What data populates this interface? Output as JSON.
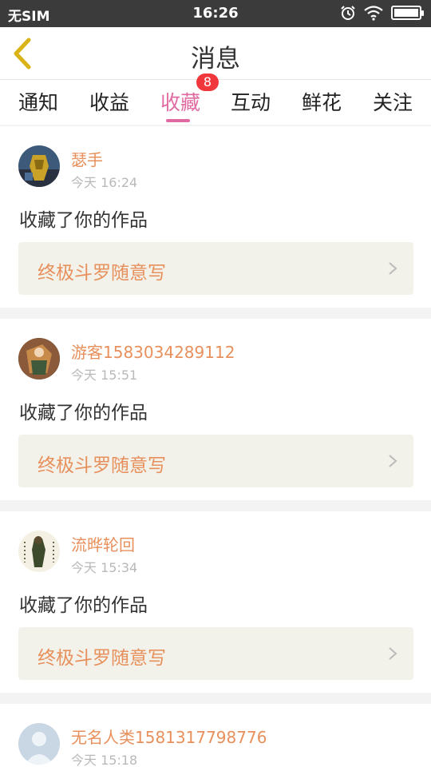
{
  "status_bar": {
    "carrier": "无SIM",
    "time": "16:26",
    "battery_level": 1.0
  },
  "nav": {
    "title": "消息",
    "back_icon": "chevron-left-icon"
  },
  "tabs": [
    {
      "label": "通知"
    },
    {
      "label": "收益"
    },
    {
      "label": "收藏",
      "active": true,
      "badge": "8"
    },
    {
      "label": "互动"
    },
    {
      "label": "鲜花"
    },
    {
      "label": "关注"
    }
  ],
  "messages": [
    {
      "user": "瑟手",
      "time": "今天 16:24",
      "action": "收藏了你的作品",
      "work": "终极斗罗随意写"
    },
    {
      "user": "游客1583034289112",
      "time": "今天 15:51",
      "action": "收藏了你的作品",
      "work": "终极斗罗随意写"
    },
    {
      "user": "流晔轮回",
      "time": "今天 15:34",
      "action": "收藏了你的作品",
      "work": "终极斗罗随意写"
    },
    {
      "user": "无名人类1581317798776",
      "time": "今天 15:18"
    }
  ],
  "colors": {
    "accent": "#e06aa2",
    "username": "#e8905c",
    "badge": "#f0373c",
    "back_icon": "#d9b317"
  }
}
